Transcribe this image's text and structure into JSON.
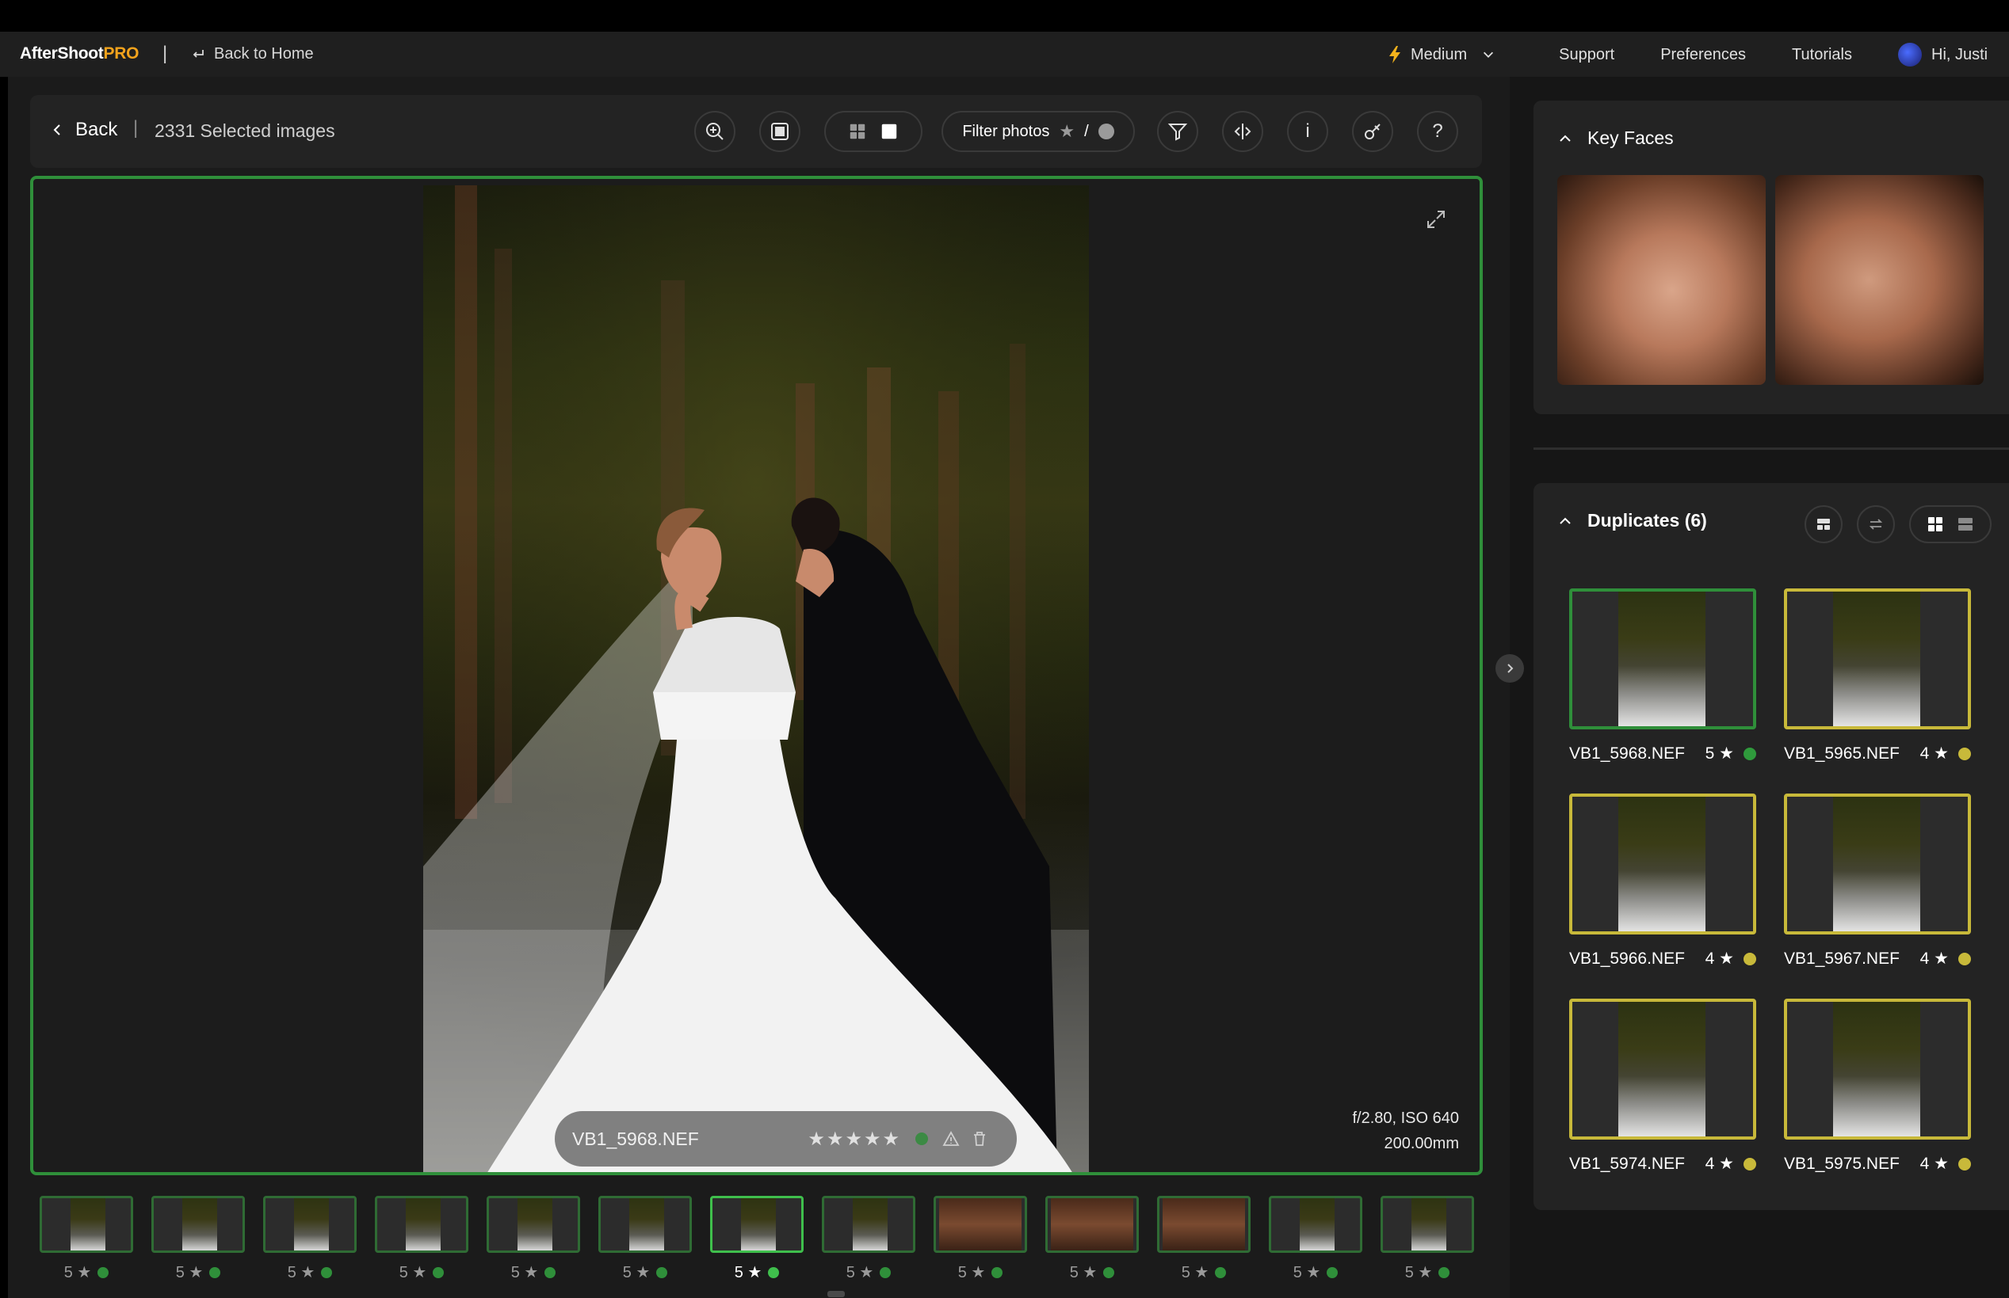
{
  "app": {
    "logo_main": "AfterShoot",
    "logo_pro": "PRO",
    "separator": "|",
    "back_home": "Back to Home",
    "quality": "Medium",
    "nav": [
      "Support",
      "Preferences",
      "Tutorials"
    ],
    "user_greeting": "Hi, Justi"
  },
  "toolbar": {
    "back_label": "Back",
    "separator": "|",
    "selected_count": "2331 Selected images",
    "filter_label": "Filter photos",
    "filter_slash": "/",
    "help_label": "?",
    "info_label": "i"
  },
  "viewer": {
    "filename": "VB1_5968.NEF",
    "stars": "★★★★★",
    "exif_line1": "f/2.80, ISO 640",
    "exif_line2": "200.00mm"
  },
  "filmstrip": [
    {
      "label": "5 ★",
      "selected": false,
      "warm": false
    },
    {
      "label": "5 ★",
      "selected": false,
      "warm": false
    },
    {
      "label": "5 ★",
      "selected": false,
      "warm": false
    },
    {
      "label": "5 ★",
      "selected": false,
      "warm": false
    },
    {
      "label": "5 ★",
      "selected": false,
      "warm": false
    },
    {
      "label": "5 ★",
      "selected": false,
      "warm": false
    },
    {
      "label": "5 ★",
      "selected": true,
      "warm": false
    },
    {
      "label": "5 ★",
      "selected": false,
      "warm": false
    },
    {
      "label": "5 ★",
      "selected": false,
      "warm": true
    },
    {
      "label": "5 ★",
      "selected": false,
      "warm": true
    },
    {
      "label": "5 ★",
      "selected": false,
      "warm": true
    },
    {
      "label": "5 ★",
      "selected": false,
      "warm": false
    },
    {
      "label": "5 ★",
      "selected": false,
      "warm": false
    }
  ],
  "key_faces": {
    "title": "Key Faces"
  },
  "duplicates": {
    "title": "Duplicates (6)",
    "items": [
      {
        "name": "VB1_5968.NEF",
        "rating": "5 ★",
        "status": "best"
      },
      {
        "name": "VB1_5965.NEF",
        "rating": "4 ★",
        "status": "duplicate"
      },
      {
        "name": "VB1_5966.NEF",
        "rating": "4 ★",
        "status": "duplicate"
      },
      {
        "name": "VB1_5967.NEF",
        "rating": "4 ★",
        "status": "duplicate"
      },
      {
        "name": "VB1_5974.NEF",
        "rating": "4 ★",
        "status": "duplicate"
      },
      {
        "name": "VB1_5975.NEF",
        "rating": "4 ★",
        "status": "duplicate"
      }
    ]
  },
  "colors": {
    "accent_green": "#2f8f3a",
    "accent_yellow": "#c8b93a",
    "brand_orange": "#f2a31c"
  }
}
